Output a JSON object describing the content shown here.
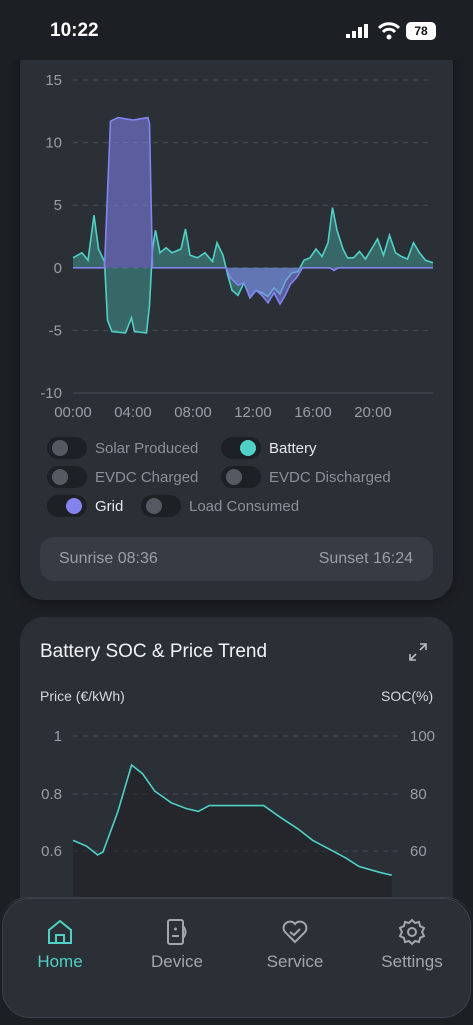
{
  "status_bar": {
    "time": "10:22",
    "battery": "78"
  },
  "power_chart": {
    "chart_data": {
      "type": "line",
      "x_ticks": [
        "00:00",
        "04:00",
        "08:00",
        "12:00",
        "16:00",
        "20:00"
      ],
      "y_ticks": [
        "15",
        "10",
        "5",
        "0",
        "-5",
        "-10"
      ],
      "ylim": [
        -10,
        15
      ],
      "xlim": [
        0,
        24
      ],
      "series": [
        {
          "name": "Battery",
          "color": "#4fd1c5",
          "points": [
            [
              0,
              0.8
            ],
            [
              0.6,
              1.2
            ],
            [
              1,
              0.6
            ],
            [
              1.4,
              4.2
            ],
            [
              1.7,
              1.5
            ],
            [
              2.1,
              0.5
            ],
            [
              2.3,
              -4.2
            ],
            [
              2.6,
              -5.1
            ],
            [
              3.5,
              -5.2
            ],
            [
              3.9,
              -4.0
            ],
            [
              4.1,
              -5.1
            ],
            [
              4.9,
              -5.2
            ],
            [
              5.1,
              -3.0
            ],
            [
              5.3,
              1.5
            ],
            [
              5.5,
              3.0
            ],
            [
              5.8,
              1.2
            ],
            [
              6.2,
              1.6
            ],
            [
              6.6,
              1.2
            ],
            [
              7.2,
              1.5
            ],
            [
              7.5,
              3.1
            ],
            [
              7.8,
              1.0
            ],
            [
              8.3,
              0.8
            ],
            [
              8.8,
              1.2
            ],
            [
              9.3,
              0.5
            ],
            [
              9.6,
              2.0
            ],
            [
              10,
              1.0
            ],
            [
              10.3,
              -0.5
            ],
            [
              10.6,
              -1.8
            ],
            [
              11,
              -2.2
            ],
            [
              11.4,
              -1.2
            ],
            [
              11.8,
              -2.4
            ],
            [
              12.2,
              -1.8
            ],
            [
              12.6,
              -2.0
            ],
            [
              13.0,
              -2.3
            ],
            [
              13.4,
              -1.6
            ],
            [
              13.8,
              -2.1
            ],
            [
              14.2,
              -1.0
            ],
            [
              14.6,
              -0.4
            ],
            [
              15.0,
              -0.3
            ],
            [
              15.4,
              0.6
            ],
            [
              15.8,
              0.8
            ],
            [
              16.2,
              1.5
            ],
            [
              16.6,
              0.9
            ],
            [
              17.0,
              2.0
            ],
            [
              17.3,
              4.8
            ],
            [
              17.6,
              3.0
            ],
            [
              18.0,
              1.5
            ],
            [
              18.3,
              0.8
            ],
            [
              18.7,
              0.8
            ],
            [
              19.1,
              1.3
            ],
            [
              19.5,
              0.7
            ],
            [
              19.9,
              1.5
            ],
            [
              20.3,
              2.3
            ],
            [
              20.7,
              1.0
            ],
            [
              21.1,
              2.6
            ],
            [
              21.5,
              1.2
            ],
            [
              21.9,
              0.9
            ],
            [
              22.3,
              0.7
            ],
            [
              22.7,
              2.0
            ],
            [
              23.1,
              1.2
            ],
            [
              23.5,
              0.6
            ],
            [
              24,
              0.4
            ]
          ]
        },
        {
          "name": "Grid",
          "color": "#8383f0",
          "points": [
            [
              0,
              0
            ],
            [
              2.1,
              0
            ],
            [
              2.3,
              6
            ],
            [
              2.5,
              11.7
            ],
            [
              3,
              12.0
            ],
            [
              4,
              11.8
            ],
            [
              5,
              12.0
            ],
            [
              5.1,
              11.5
            ],
            [
              5.3,
              0
            ],
            [
              10.2,
              0
            ],
            [
              10.5,
              -0.8
            ],
            [
              11,
              -1.4
            ],
            [
              11.4,
              -1.2
            ],
            [
              11.8,
              -2.4
            ],
            [
              12.2,
              -1.8
            ],
            [
              12.6,
              -2.2
            ],
            [
              13,
              -2.8
            ],
            [
              13.4,
              -2.0
            ],
            [
              13.8,
              -2.9
            ],
            [
              14.1,
              -2.3
            ],
            [
              14.5,
              -1.3
            ],
            [
              14.9,
              -0.8
            ],
            [
              15.3,
              0
            ],
            [
              17.1,
              0
            ],
            [
              17.4,
              -0.2
            ],
            [
              17.7,
              0
            ],
            [
              24,
              0
            ]
          ]
        }
      ]
    },
    "legend": [
      {
        "label": "Solar Produced",
        "on": false
      },
      {
        "label": "Battery",
        "on": true,
        "color": "#4fd1c5"
      },
      {
        "label": "EVDC Charged",
        "on": false
      },
      {
        "label": "EVDC Discharged",
        "on": false
      },
      {
        "label": "Grid",
        "on": true,
        "color": "#8383f0"
      },
      {
        "label": "Load Consumed",
        "on": false
      }
    ],
    "sunrise": "Sunrise 08:36",
    "sunset": "Sunset 16:24"
  },
  "soc_chart": {
    "title": "Battery SOC & Price Trend",
    "left_axis_label": "Price (€/kWh)",
    "right_axis_label": "SOC(%)",
    "chart_data": {
      "type": "line",
      "left_ticks": [
        "1",
        "0.8",
        "0.6"
      ],
      "right_ticks": [
        "100",
        "80",
        "60"
      ],
      "ylim_left": [
        0.52,
        1
      ],
      "series": [
        {
          "name": "Price",
          "color": "#4fd1c5",
          "points": [
            [
              0,
              0.64
            ],
            [
              1,
              0.62
            ],
            [
              1.8,
              0.59
            ],
            [
              2.2,
              0.6
            ],
            [
              3.3,
              0.74
            ],
            [
              4.3,
              0.9
            ],
            [
              5.1,
              0.87
            ],
            [
              6.0,
              0.81
            ],
            [
              7.2,
              0.77
            ],
            [
              8.3,
              0.75
            ],
            [
              9.2,
              0.74
            ],
            [
              10.0,
              0.76
            ],
            [
              12,
              0.76
            ],
            [
              14,
              0.76
            ],
            [
              15.2,
              0.72
            ],
            [
              16.5,
              0.68
            ],
            [
              17.6,
              0.64
            ],
            [
              18.8,
              0.61
            ],
            [
              20.0,
              0.58
            ],
            [
              21.0,
              0.55
            ],
            [
              22.5,
              0.53
            ],
            [
              23.4,
              0.52
            ]
          ]
        }
      ]
    }
  },
  "nav": [
    {
      "label": "Home",
      "icon": "home-icon",
      "active": true
    },
    {
      "label": "Device",
      "icon": "device-icon",
      "active": false
    },
    {
      "label": "Service",
      "icon": "service-icon",
      "active": false
    },
    {
      "label": "Settings",
      "icon": "gear-icon",
      "active": false
    }
  ]
}
